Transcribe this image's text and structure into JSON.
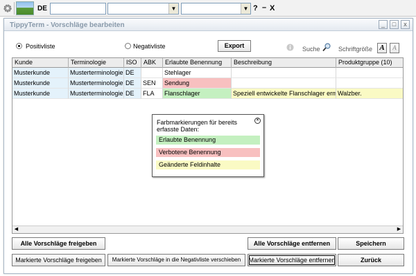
{
  "toolbar": {
    "language": "DE",
    "help": "?",
    "minimize": "–",
    "close": "X",
    "field1": "",
    "field2": "",
    "field3": ""
  },
  "window": {
    "title": "TippyTerm - Vorschläge bearbeiten",
    "minimize_btn": "_",
    "maximize_btn": "□",
    "close_btn": "x"
  },
  "filter": {
    "positive_label": "Positivliste",
    "negative_label": "Negativliste",
    "selected": "Positivliste",
    "export_label": "Export",
    "search_label": "Suche",
    "fontsize_label": "Schriftgröße"
  },
  "table": {
    "headers": [
      "Kunde",
      "Terminologie",
      "ISO",
      "ABK",
      "Erlaubte Benennung",
      "Beschreibung",
      "Produktgruppe (10)"
    ],
    "rows": [
      [
        "Musterkunde",
        "Musterterminologie",
        "DE",
        "",
        "Stehlager",
        "",
        ""
      ],
      [
        "Musterkunde",
        "Musterterminologie",
        "DE",
        "SEN",
        "Sendung",
        "",
        ""
      ],
      [
        "Musterkunde",
        "Musterterminologie",
        "DE",
        "FLA",
        "Flanschlager",
        "Speziell entwickelte Flanschlager ermö...",
        "Walzber."
      ]
    ],
    "row_highlight": [
      "none",
      "red",
      "green"
    ]
  },
  "legend": {
    "title": "Farbmarkierungen für bereits erfasste Daten:",
    "items": [
      {
        "label": "Erlaubte Benennung",
        "color": "#c4f0c0"
      },
      {
        "label": "Verbotene Benennung",
        "color": "#f8c0c0"
      },
      {
        "label": "Geänderte Feldinhalte",
        "color": "#fafac4"
      }
    ]
  },
  "buttons": {
    "release_all": "Alle Vorschläge freigeben",
    "remove_all": "Alle Vorschläge entfernen",
    "save": "Speichern",
    "release_marked": "Markierte Vorschläge freigeben",
    "move_marked_negative": "Markierte Vorschläge in die Negativliste verschieben",
    "remove_marked": "Markierte Vorschläge entfernen",
    "back": "Zurück"
  },
  "colors": {
    "allowed": "#c4f0c0",
    "forbidden": "#f8c0c0",
    "changed": "#fafac4",
    "key_column": "#e4f2fb"
  }
}
